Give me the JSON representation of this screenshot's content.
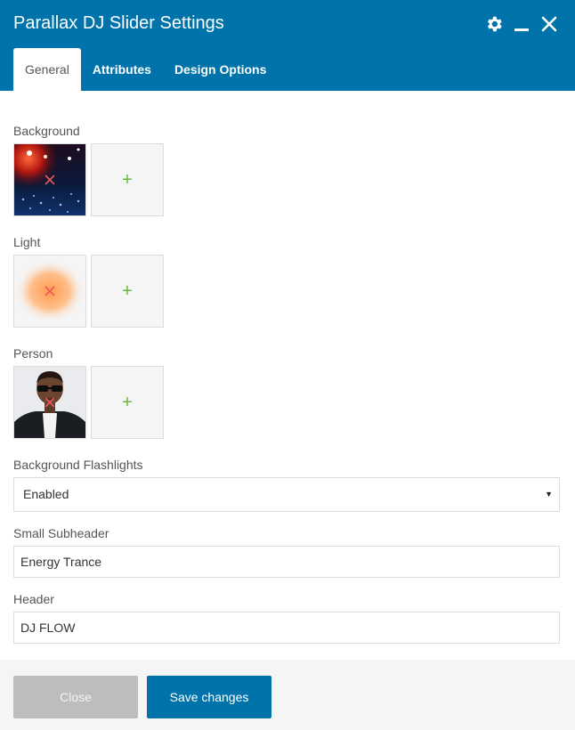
{
  "window": {
    "title": "Parallax DJ Slider Settings"
  },
  "tabs": [
    {
      "label": "General"
    },
    {
      "label": "Attributes"
    },
    {
      "label": "Design Options"
    }
  ],
  "fields": {
    "background": {
      "label": "Background"
    },
    "light": {
      "label": "Light"
    },
    "person": {
      "label": "Person"
    },
    "flashlights": {
      "label": "Background Flashlights",
      "value": "Enabled"
    },
    "subheader": {
      "label": "Small Subheader",
      "value": "Energy Trance"
    },
    "header": {
      "label": "Header",
      "value": "DJ FLOW"
    }
  },
  "footer": {
    "close_label": "Close",
    "save_label": "Save changes"
  },
  "icons": {
    "add": "+",
    "settings": "gear-icon",
    "minimize": "minimize-icon",
    "close": "close-icon",
    "remove": "remove-icon"
  },
  "colors": {
    "brand": "#0073aa",
    "add": "#6cb53e",
    "remove": "#e8585a"
  }
}
